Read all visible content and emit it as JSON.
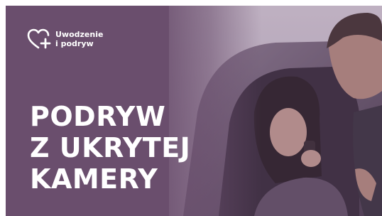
{
  "brand": {
    "logo_line1": "Uwodzenie",
    "logo_line2": "i podryw",
    "logo_icon": "heart-plus-icon"
  },
  "headline": {
    "line1": "PODRYW",
    "line2": "Z UKRYTEJ",
    "line3": "KAMERY"
  },
  "colors": {
    "overlay": "#6b4f6e",
    "text": "#ffffff"
  }
}
